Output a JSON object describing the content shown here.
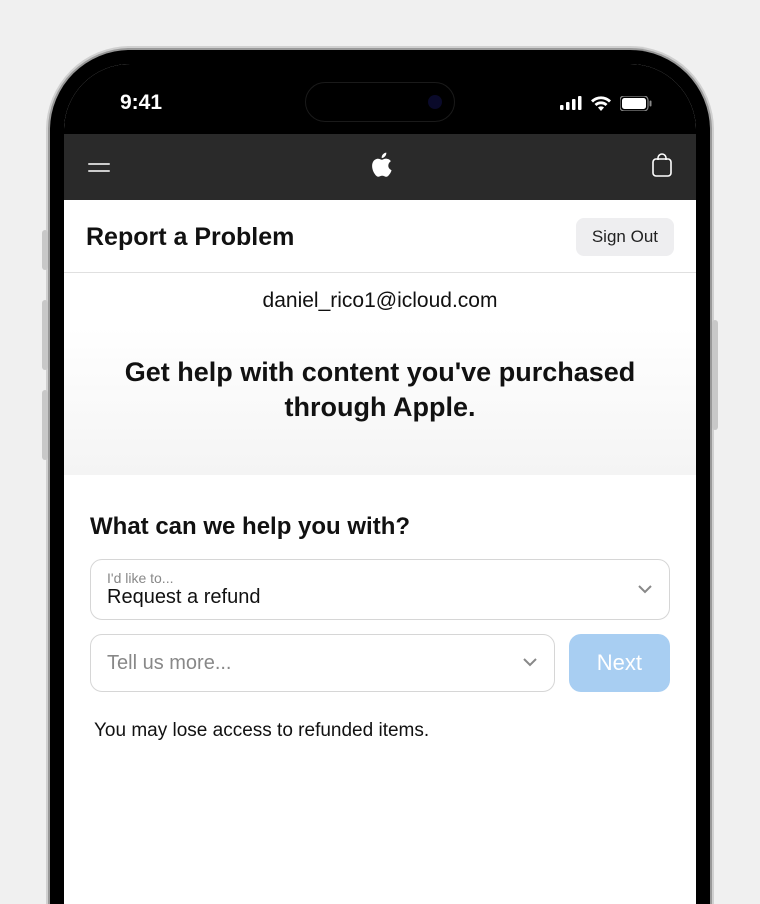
{
  "status_bar": {
    "time": "9:41"
  },
  "header": {
    "page_title": "Report a Problem",
    "sign_out_label": "Sign Out"
  },
  "user": {
    "email": "daniel_rico1@icloud.com"
  },
  "hero": {
    "heading": "Get help with content you've purchased through Apple."
  },
  "help": {
    "question": "What can we help you with?",
    "select1": {
      "label": "I'd like to...",
      "value": "Request a refund"
    },
    "select2": {
      "placeholder": "Tell us more..."
    },
    "next_label": "Next",
    "warning": "You may lose access to refunded items."
  }
}
